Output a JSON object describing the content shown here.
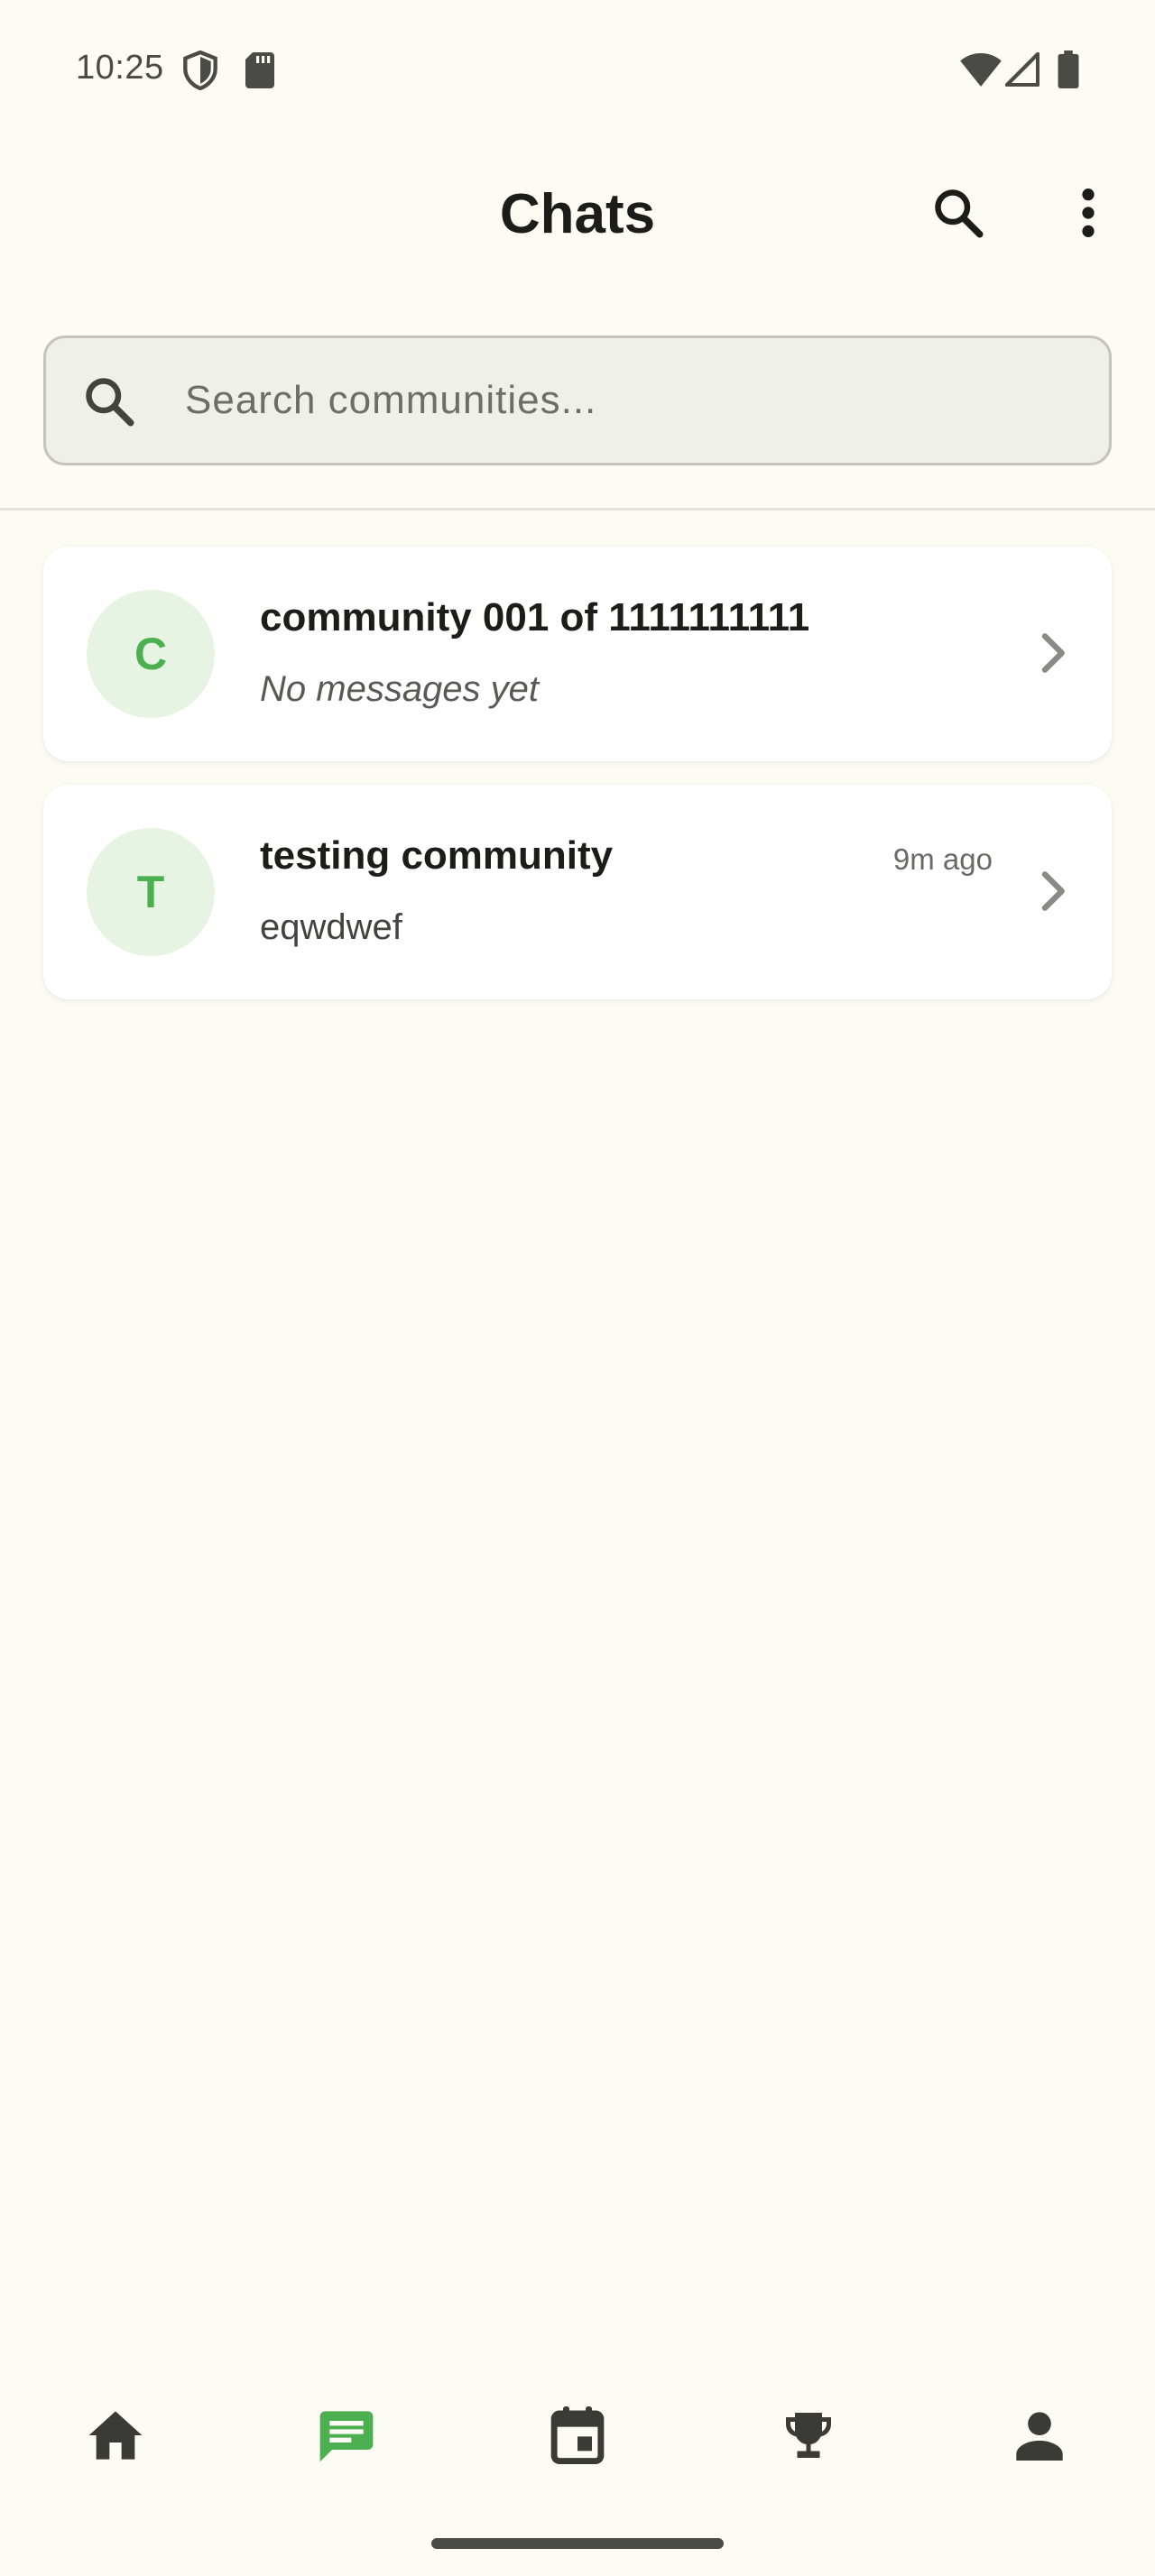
{
  "status_bar": {
    "time": "10:25",
    "left_icons": [
      "shield-icon",
      "sd-card-icon"
    ],
    "right_icons": [
      "wifi-icon",
      "signal-icon",
      "battery-icon"
    ]
  },
  "app_bar": {
    "title": "Chats",
    "actions": [
      "search-icon",
      "more-vert-icon"
    ]
  },
  "search": {
    "placeholder": "Search communities...",
    "value": ""
  },
  "chats": [
    {
      "avatar_letter": "C",
      "name": "community 001 of 1111111111",
      "preview": "No messages yet",
      "time": ""
    },
    {
      "avatar_letter": "T",
      "name": "testing community",
      "preview": "eqwdwef",
      "time": "9m ago"
    }
  ],
  "bottom_nav": {
    "items": [
      "home-icon",
      "chat-icon",
      "calendar-icon",
      "trophy-icon",
      "person-icon"
    ],
    "active": "chat-icon"
  },
  "colors": {
    "background": "#fcfcf5",
    "accent": "#4caf50",
    "avatar_bg": "#e7f3e3",
    "icon": "#3a3a36"
  }
}
